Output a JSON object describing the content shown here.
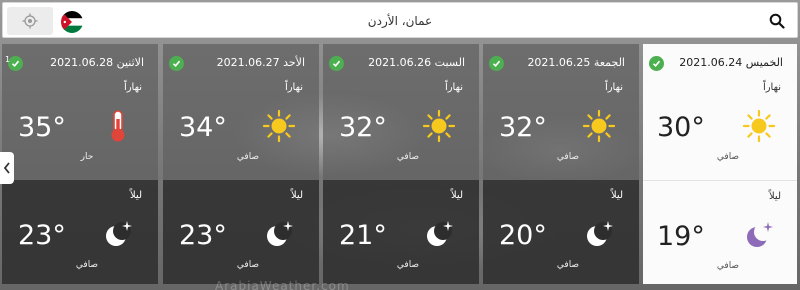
{
  "search": {
    "location": "عمان، الأردن"
  },
  "badge_count": "1",
  "watermark": "ArabiaWeather.com",
  "days": [
    {
      "date": "الاثنين 2021.06.28",
      "day_label": "نهاراً",
      "day_temp": "35°",
      "day_icon": "thermometer-icon",
      "day_condition": "حار",
      "night_label": "ليلاً",
      "night_temp": "23°",
      "night_icon": "moon-icon",
      "night_condition": "صافي"
    },
    {
      "date": "الأحد 2021.06.27",
      "day_label": "نهاراً",
      "day_temp": "34°",
      "day_icon": "sun-icon",
      "day_condition": "صافي",
      "night_label": "ليلاً",
      "night_temp": "23°",
      "night_icon": "moon-icon",
      "night_condition": "صافي"
    },
    {
      "date": "السبت 2021.06.26",
      "day_label": "نهاراً",
      "day_temp": "32°",
      "day_icon": "sun-icon",
      "day_condition": "صافي",
      "night_label": "ليلاً",
      "night_temp": "21°",
      "night_icon": "moon-icon",
      "night_condition": "صافي"
    },
    {
      "date": "الجمعة 2021.06.25",
      "day_label": "نهاراً",
      "day_temp": "32°",
      "day_icon": "sun-icon",
      "day_condition": "صافي",
      "night_label": "ليلاً",
      "night_temp": "20°",
      "night_icon": "moon-icon",
      "night_condition": "صافي"
    },
    {
      "date": "الخميس 2021.06.24",
      "day_label": "نهاراً",
      "day_temp": "30°",
      "day_icon": "sun-icon",
      "day_condition": "صافي",
      "night_label": "ليلاً",
      "night_temp": "19°",
      "night_icon": "moon-icon",
      "night_condition": "صافي",
      "selected": true
    }
  ],
  "colors": {
    "check_green": "#4caf50",
    "sun_yellow": "#f7c81e",
    "thermometer_red": "#e0453a",
    "moon_purple": "#8e6bb8"
  }
}
